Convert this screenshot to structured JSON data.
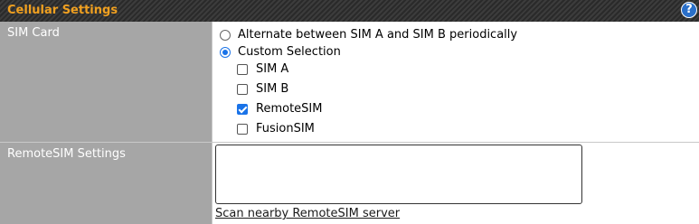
{
  "header": {
    "title": "Cellular Settings",
    "help_icon": "help-icon",
    "help_glyph": "?"
  },
  "sim_card": {
    "label": "SIM Card",
    "radio_options": [
      {
        "label": "Alternate between SIM A and SIM B periodically",
        "selected": false
      },
      {
        "label": "Custom Selection",
        "selected": true
      }
    ],
    "checkboxes": [
      {
        "label": "SIM A",
        "checked": false
      },
      {
        "label": "SIM B",
        "checked": false
      },
      {
        "label": "RemoteSIM",
        "checked": true
      },
      {
        "label": "FusionSIM",
        "checked": false
      }
    ]
  },
  "remotesim": {
    "label": "RemoteSIM Settings",
    "textarea_value": "",
    "scan_link": "Scan nearby RemoteSIM server"
  },
  "colors": {
    "header_title": "#f0a020",
    "label_bg": "#a6a6a6",
    "accent": "#1a73e8"
  }
}
